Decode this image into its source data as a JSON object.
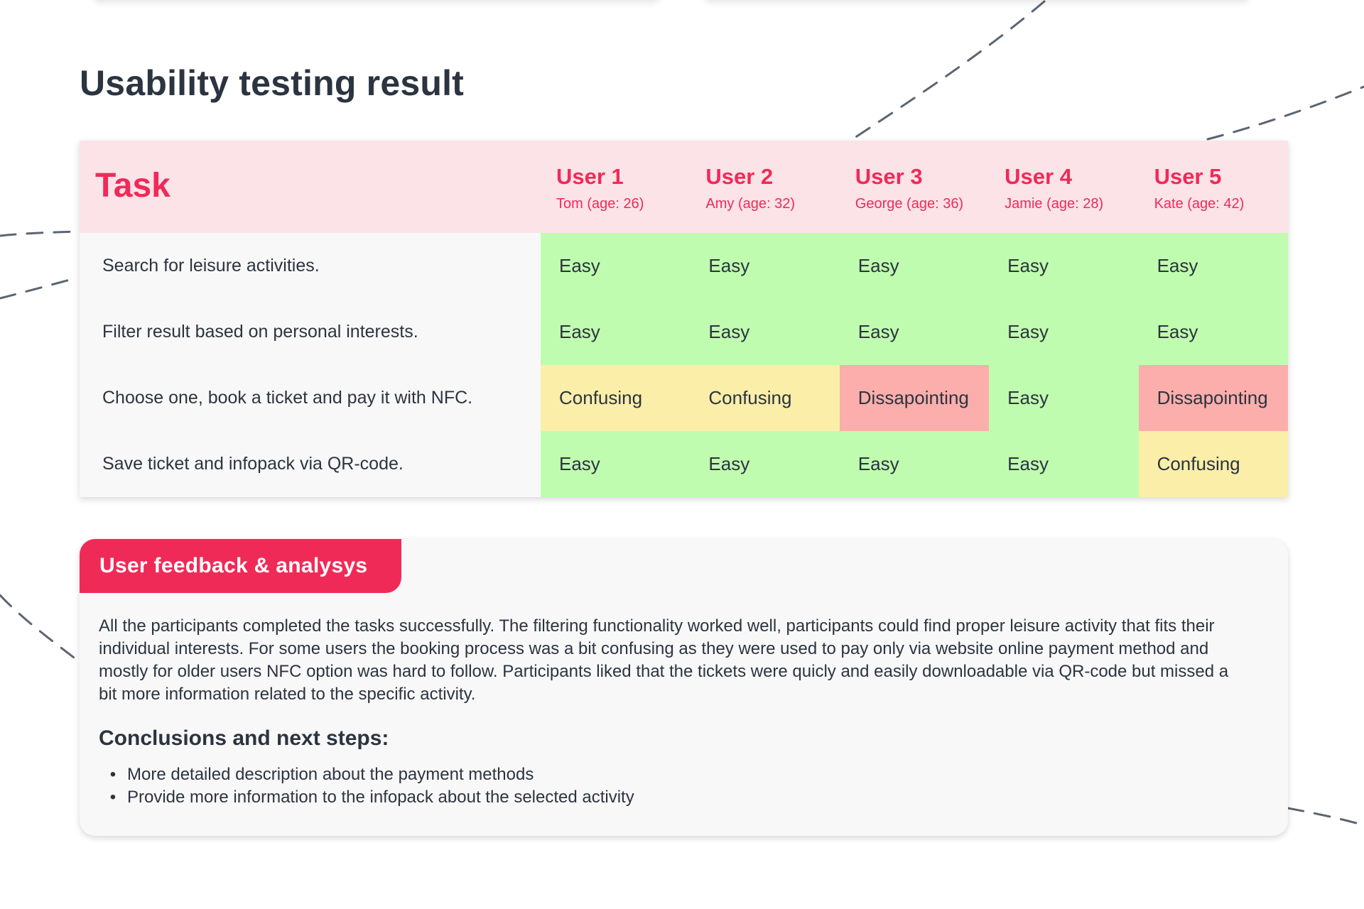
{
  "title": "Usability testing result",
  "colors": {
    "accent": "#f02a57",
    "header_bg": "#fbe3e8",
    "easy": "#c0fcaf",
    "confusing": "#faeea8",
    "dissapointing": "#fbaeac",
    "text": "#2b3440"
  },
  "table": {
    "task_header": "Task",
    "users": [
      {
        "name": "User 1",
        "meta": "Tom (age: 26)"
      },
      {
        "name": "User 2",
        "meta": "Amy (age: 32)"
      },
      {
        "name": "User 3",
        "meta": "George (age: 36)"
      },
      {
        "name": "User 4",
        "meta": "Jamie (age: 28)"
      },
      {
        "name": "User 5",
        "meta": "Kate (age: 42)"
      }
    ],
    "tasks": [
      {
        "label": "Search for leisure activities.",
        "results": [
          "Easy",
          "Easy",
          "Easy",
          "Easy",
          "Easy"
        ]
      },
      {
        "label": "Filter result based on personal interests.",
        "results": [
          "Easy",
          "Easy",
          "Easy",
          "Easy",
          "Easy"
        ]
      },
      {
        "label": "Choose one, book a ticket and pay it with NFC.",
        "results": [
          "Confusing",
          "Confusing",
          "Dissapointing",
          "Easy",
          "Dissapointing"
        ]
      },
      {
        "label": "Save ticket and infopack via QR-code.",
        "results": [
          "Easy",
          "Easy",
          "Easy",
          "Easy",
          "Confusing"
        ]
      }
    ]
  },
  "feedback": {
    "tab_label": "User feedback & analysys",
    "text": "All the participants completed the tasks successfully. The filtering functionality worked well, participants could find proper leisure activity that fits their individual interests. For some users the booking process was a bit confusing as they were used to pay only via website online payment method and mostly for older users NFC option was hard to follow. Participants liked that the tickets were quicly and easily downloadable via QR-code but missed a bit more information related to the specific activity.",
    "conclusions_heading": "Conclusions and next steps:",
    "bullet": "•",
    "steps": [
      "More detailed description about the payment methods",
      "Provide more information to the infopack about the selected activity"
    ]
  }
}
